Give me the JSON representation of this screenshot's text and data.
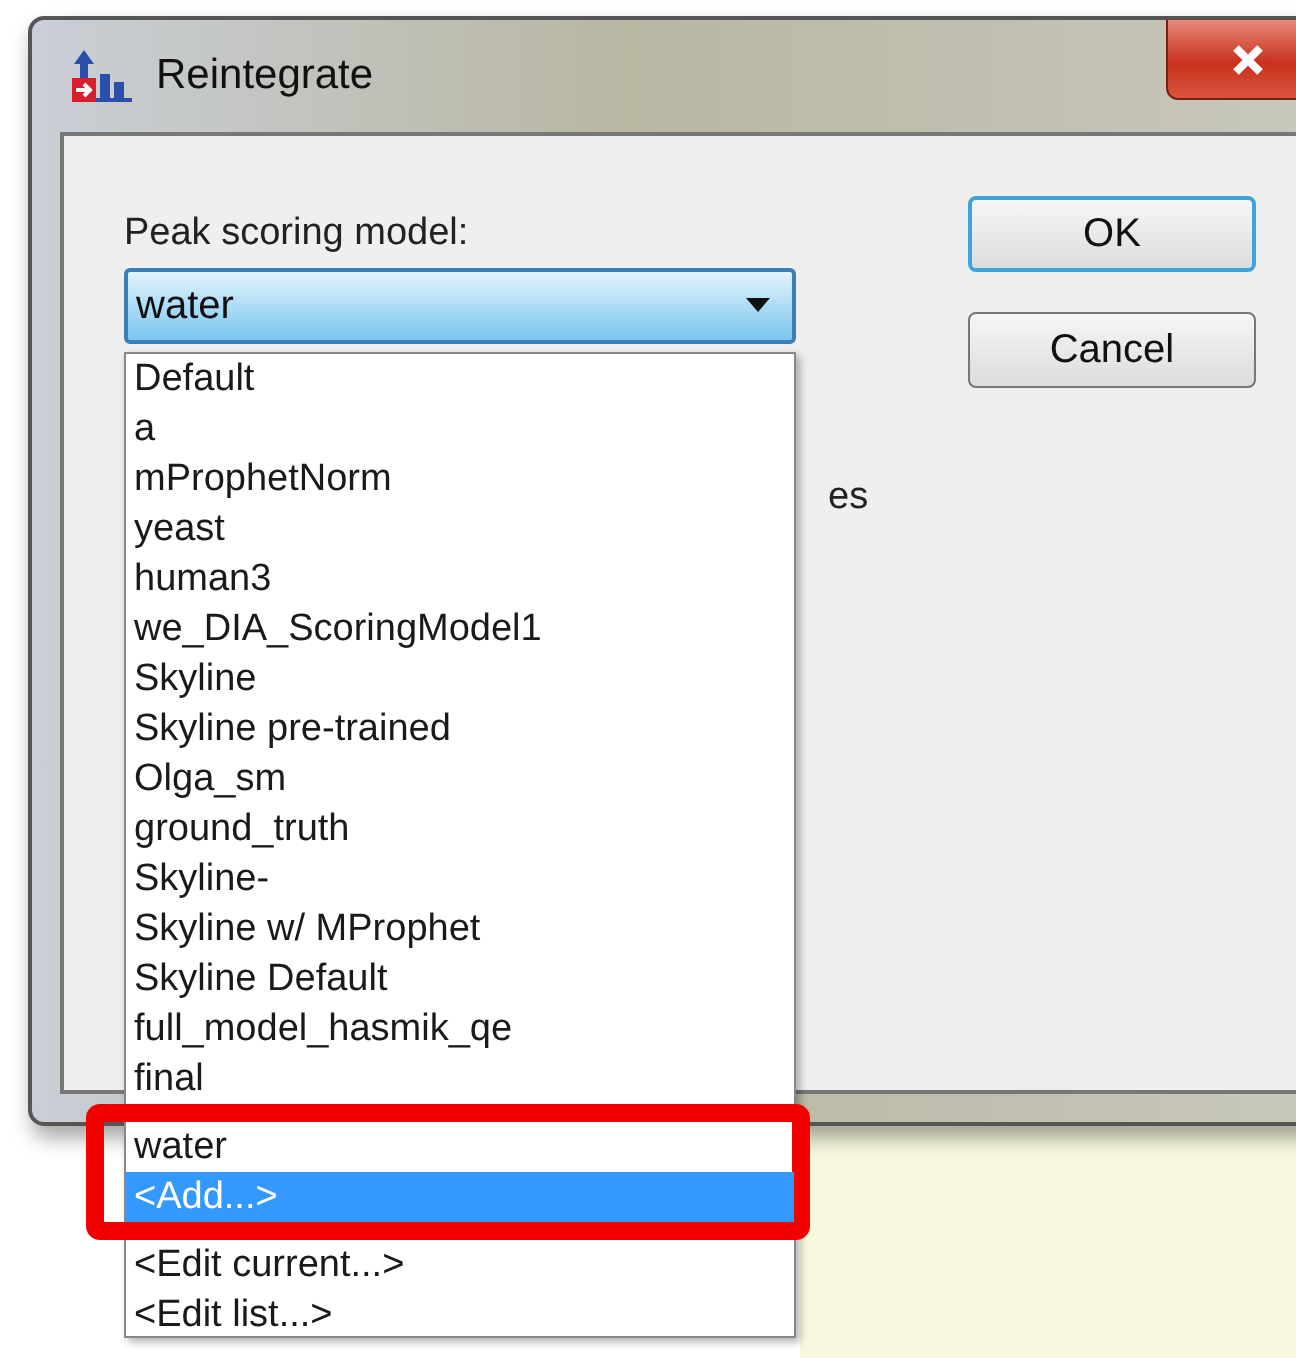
{
  "window": {
    "title": "Reintegrate"
  },
  "field_label": "Peak scoring model:",
  "combo": {
    "value": "water",
    "expanded": true
  },
  "options": [
    {
      "label": "Default",
      "selected": false
    },
    {
      "label": "a",
      "selected": false
    },
    {
      "label": "mProphetNorm",
      "selected": false
    },
    {
      "label": "yeast",
      "selected": false
    },
    {
      "label": "human3",
      "selected": false
    },
    {
      "label": "we_DIA_ScoringModel1",
      "selected": false
    },
    {
      "label": "Skyline",
      "selected": false
    },
    {
      "label": "Skyline pre-trained",
      "selected": false
    },
    {
      "label": "Olga_sm",
      "selected": false
    },
    {
      "label": "ground_truth",
      "selected": false
    },
    {
      "label": "Skyline-",
      "selected": false
    },
    {
      "label": "Skyline w/ MProphet",
      "selected": false
    },
    {
      "label": "Skyline Default",
      "selected": false
    },
    {
      "label": "full_model_hasmik_qe",
      "selected": false
    },
    {
      "label": "final",
      "selected": false
    },
    {
      "label": "water",
      "selected": false
    },
    {
      "label": "<Add...>",
      "selected": true
    },
    {
      "label": "<Edit current...>",
      "selected": false
    },
    {
      "label": "<Edit list...>",
      "selected": false
    }
  ],
  "hidden_text": "es",
  "buttons": [
    {
      "label": "OK",
      "default": true
    },
    {
      "label": "Cancel",
      "default": false
    }
  ]
}
